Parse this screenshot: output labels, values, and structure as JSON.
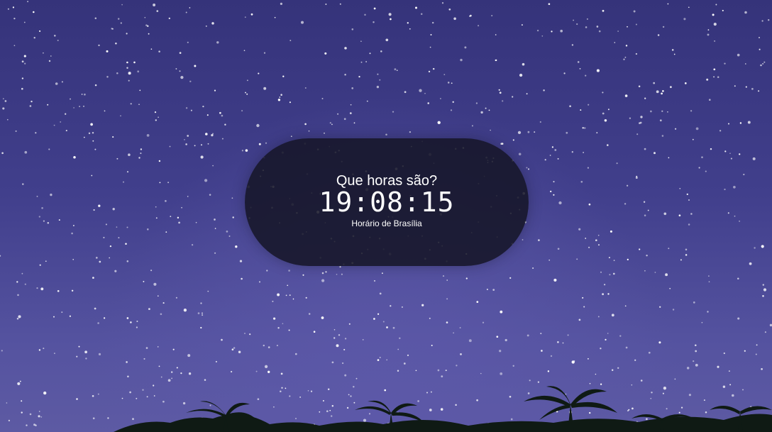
{
  "clock": {
    "question": "Que horas são?",
    "time": "19:08:15",
    "timezone": "Horário de Brasília"
  },
  "background": {
    "description_icon": "night-sky-with-palm-trees",
    "sky_color": "#3b3a7e",
    "panel_color": "#161628"
  }
}
